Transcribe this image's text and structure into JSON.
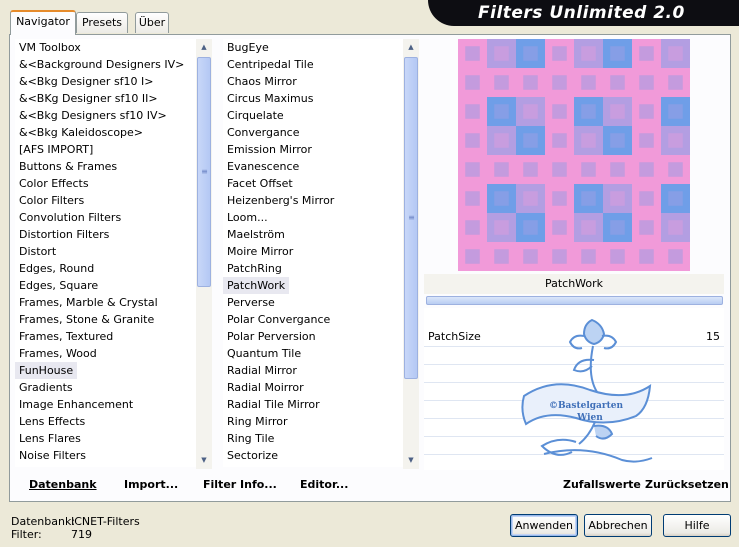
{
  "tabs": [
    {
      "label": "Navigator",
      "active": true
    },
    {
      "label": "Presets",
      "active": false
    },
    {
      "label": "Über",
      "active": false
    }
  ],
  "banner": {
    "title": "Filters Unlimited 2.0"
  },
  "categories": {
    "items": [
      "VM Toolbox",
      "&<Background Designers IV>",
      "&<Bkg Designer sf10 I>",
      "&<BKg Designer sf10 II>",
      "&<Bkg Designers sf10 IV>",
      "&<Bkg Kaleidoscope>",
      "[AFS IMPORT]",
      "Buttons & Frames",
      "Color Effects",
      "Color Filters",
      "Convolution Filters",
      "Distortion Filters",
      "Distort",
      "Edges, Round",
      "Edges, Square",
      "Frames, Marble & Crystal",
      "Frames, Stone & Granite",
      "Frames, Textured",
      "Frames, Wood",
      "FunHouse",
      "Gradients",
      "Image Enhancement",
      "Lens Effects",
      "Lens Flares",
      "Noise Filters"
    ],
    "selected": "FunHouse"
  },
  "filters": {
    "items": [
      "BugEye",
      "Centripedal Tile",
      "Chaos Mirror",
      "Circus Maximus",
      "Cirquelate",
      "Convergance",
      "Emission Mirror",
      "Evanescence",
      "Facet Offset",
      "Heizenberg's Mirror",
      "Loom...",
      "Maelström",
      "Moire Mirror",
      "PatchRing",
      "PatchWork",
      "Perverse",
      "Polar Convergance",
      "Polar Perversion",
      "Quantum Tile",
      "Radial Mirror",
      "Radial Moirror",
      "Radial Tile Mirror",
      "Ring Mirror",
      "Ring Tile",
      "Sectorize"
    ],
    "selected": "PatchWork"
  },
  "links": {
    "database": "Datenbank",
    "import": "Import...",
    "filter_info": "Filter Info...",
    "editor": "Editor...",
    "random": "Zufallswerte",
    "reset": "Zurücksetzen"
  },
  "preview": {
    "filter_name": "PatchWork",
    "colors": {
      "pink": "#f19ad9",
      "blue": "#6f9ee8",
      "mid": "#b39ee2"
    }
  },
  "params": [
    {
      "label": "PatchSize",
      "value": "15"
    }
  ],
  "watermark": {
    "line1": "©Bastelgarten",
    "line2": "Wien"
  },
  "status": {
    "db_label": "Datenbank:",
    "db_value": "ICNET-Filters",
    "filter_label": "Filter:",
    "filter_value": "719"
  },
  "buttons": {
    "apply": "Anwenden",
    "cancel": "Abbrechen",
    "help": "Hilfe"
  }
}
